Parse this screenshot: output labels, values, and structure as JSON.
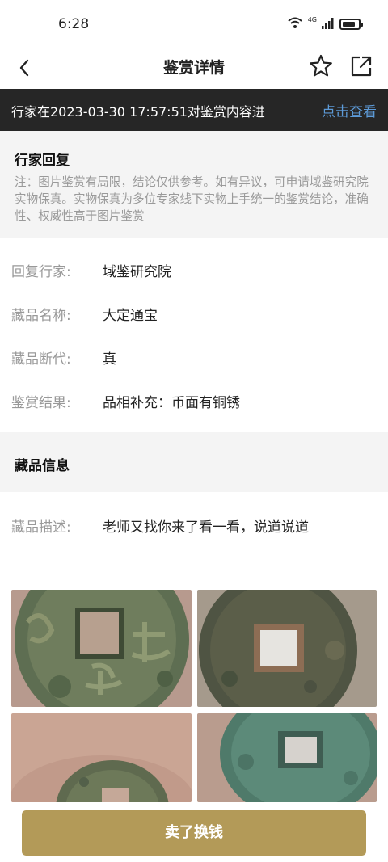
{
  "status_bar": {
    "time": "6:28",
    "network": "4G",
    "icons": [
      "wifi-icon",
      "signal-icon",
      "battery-icon"
    ]
  },
  "navbar": {
    "title": "鉴赏详情",
    "back_icon": "chevron-left-icon",
    "favorite_icon": "star-icon",
    "share_icon": "share-icon"
  },
  "notice": {
    "text": "行家在2023-03-30 17:57:51对鉴赏内容进",
    "link": "点击查看",
    "link_color": "#5d9bd8"
  },
  "reply": {
    "title": "行家回复",
    "note": "注：图片鉴赏有局限，结论仅供参考。如有异议，可申请域鉴研究院实物保真。实物保真为多位专家线下实物上手统一的鉴赏结论，准确性、权威性高于图片鉴赏"
  },
  "details": [
    {
      "label": "回复行家:",
      "value": "域鉴研究院"
    },
    {
      "label": "藏品名称:",
      "value": "大定通宝"
    },
    {
      "label": "藏品断代:",
      "value": "真"
    },
    {
      "label": "鉴赏结果:",
      "value": "品相补充：币面有铜锈"
    }
  ],
  "collection": {
    "section_title": "藏品信息",
    "description_label": "藏品描述:",
    "description_value": "老师又找你来了看一看，说道说道"
  },
  "photos": [
    "coin-photo-obverse",
    "coin-photo-reverse",
    "coin-photo-edge",
    "coin-photo-reverse-2"
  ],
  "bottom": {
    "sell_button": "卖了换钱",
    "accent_color": "#b39a58"
  }
}
